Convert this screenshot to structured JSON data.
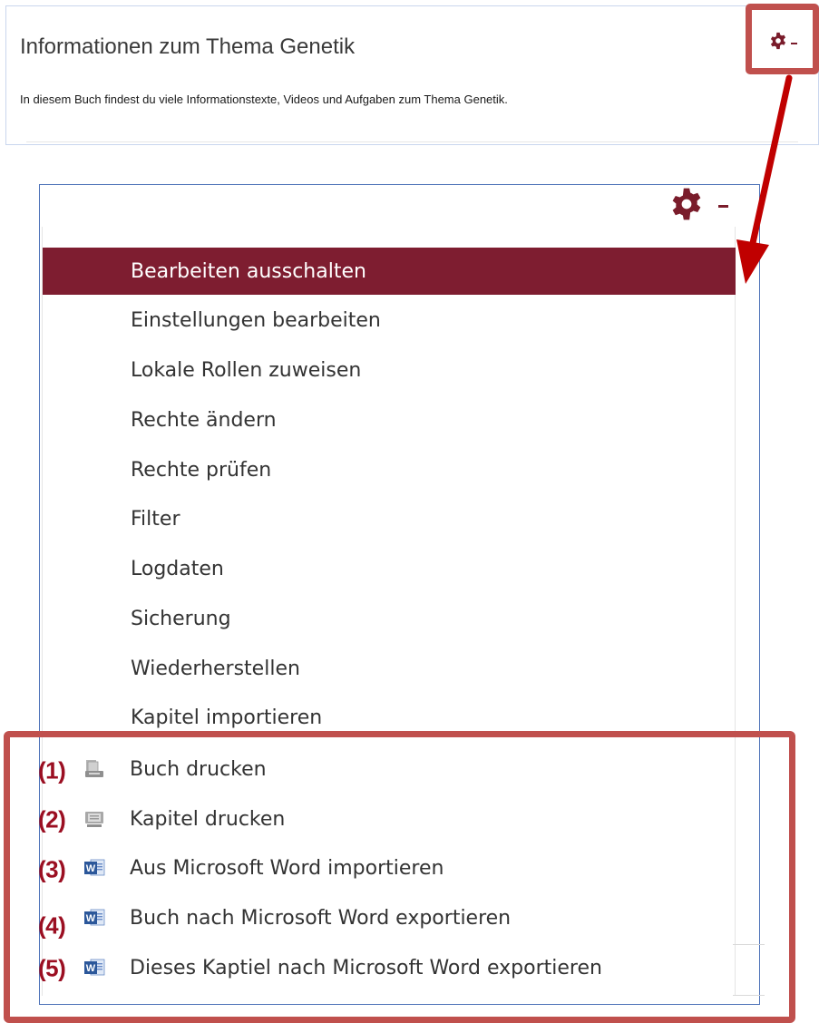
{
  "header": {
    "title": "Informationen zum Thema Genetik",
    "description": "In diesem Buch findest du viele Informationstexte, Videos und Aufgaben zum Thema Genetik."
  },
  "colors": {
    "accent": "#7e1d30",
    "highlight": "#c0504d",
    "arrow": "#c00000",
    "annotation": "#9b0f22",
    "panel_border": "#4d72b8"
  },
  "icons": {
    "settings": "gear-icon",
    "dropdown": "caret-down-icon",
    "print_book": "print-book-icon",
    "print_chapter": "print-chapter-icon",
    "word": "word-icon"
  },
  "menu": {
    "items": [
      {
        "label": "Bearbeiten ausschalten",
        "active": true
      },
      {
        "label": "Einstellungen bearbeiten"
      },
      {
        "label": "Lokale Rollen zuweisen"
      },
      {
        "label": "Rechte ändern"
      },
      {
        "label": "Rechte prüfen"
      },
      {
        "label": "Filter"
      },
      {
        "label": "Logdaten"
      },
      {
        "label": "Sicherung"
      },
      {
        "label": "Wiederherstellen"
      },
      {
        "label": "Kapitel importieren"
      },
      {
        "label": "Buch drucken",
        "number": "(1)",
        "icon": "print-book-icon"
      },
      {
        "label": "Kapitel drucken",
        "number": "(2)",
        "icon": "print-chapter-icon"
      },
      {
        "label": "Aus Microsoft Word importieren",
        "number": "(3)",
        "icon": "word-icon"
      },
      {
        "label": "Buch nach Microsoft Word exportieren",
        "number": "(4)",
        "icon": "word-icon"
      },
      {
        "label": "Dieses Kaptiel nach Microsoft Word exportieren",
        "number": "(5)",
        "icon": "word-icon"
      }
    ]
  }
}
